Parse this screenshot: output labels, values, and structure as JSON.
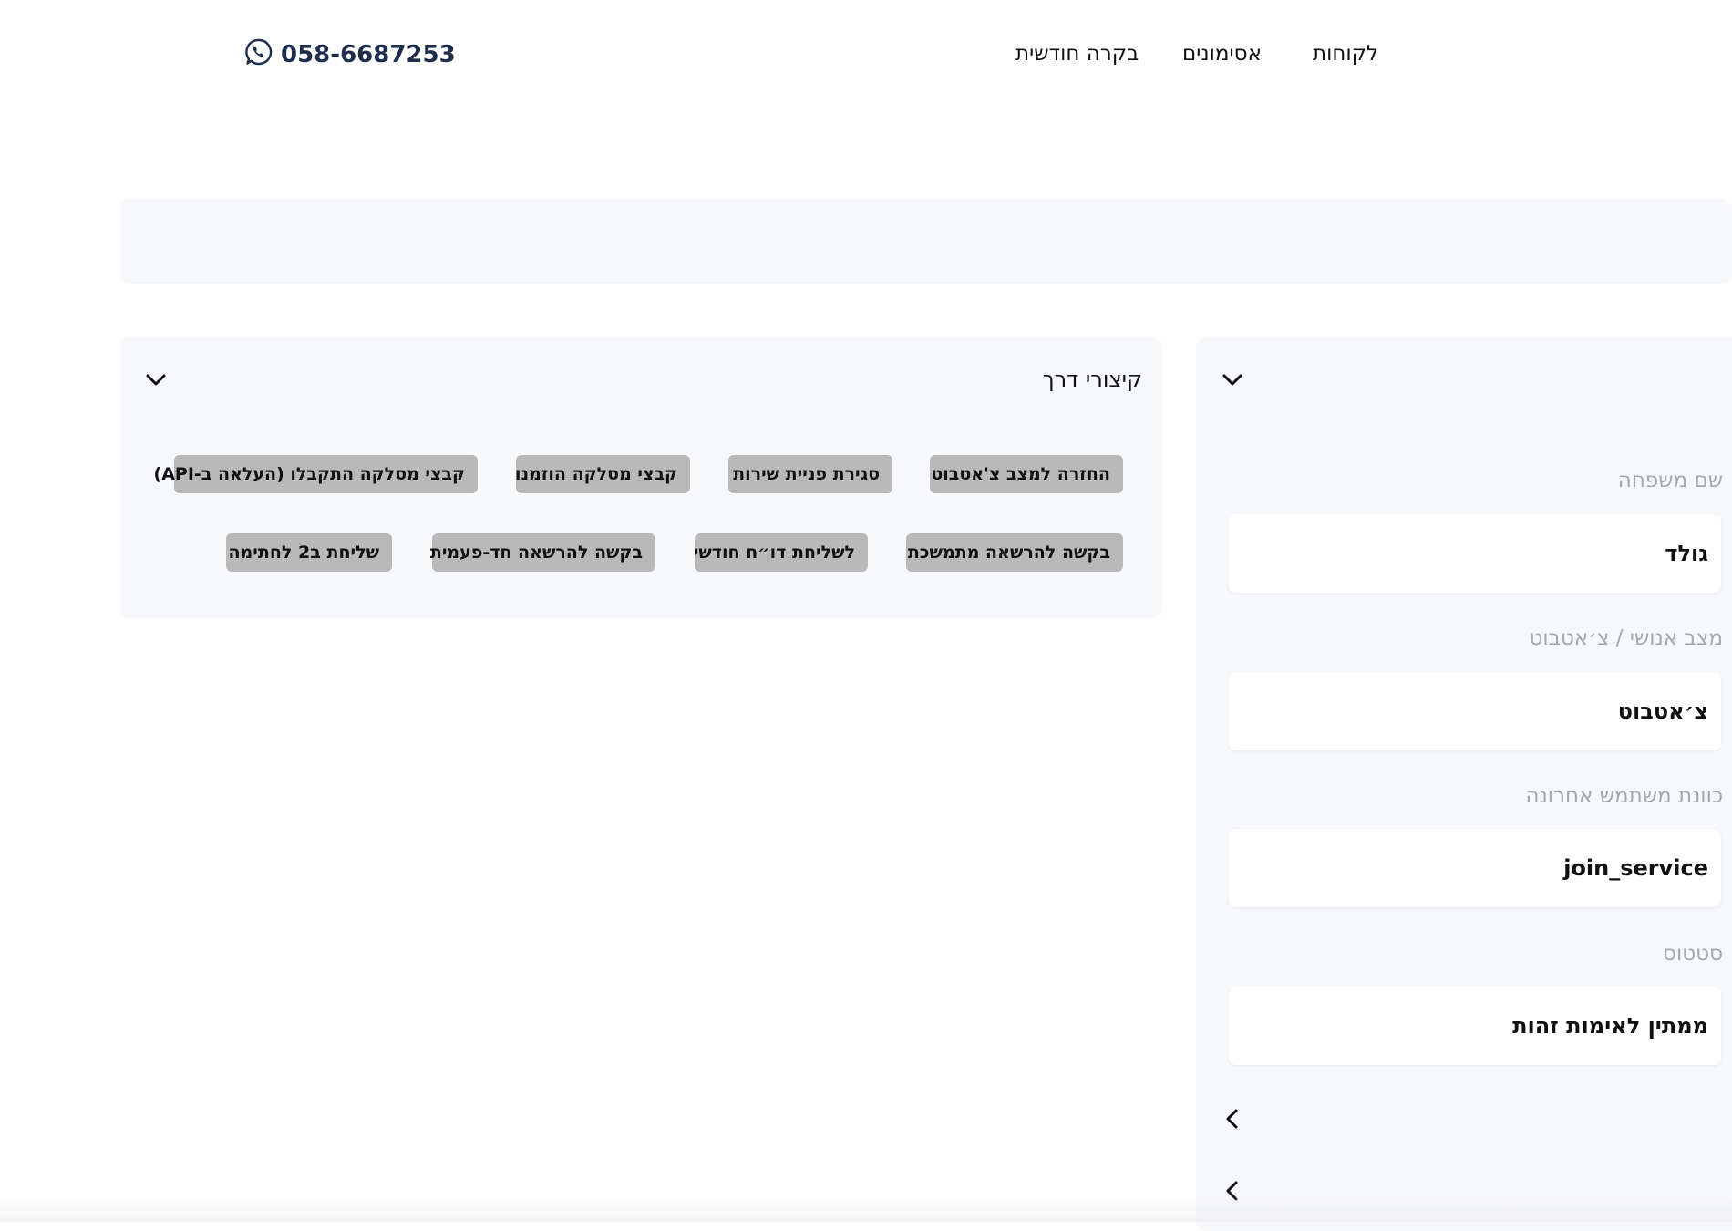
{
  "header": {
    "phone": "058-6687253",
    "phone_icon": "whatsapp-icon",
    "nav": [
      {
        "label": "לקוחות"
      },
      {
        "label": "אסימונים"
      },
      {
        "label": "בקרה חודשית"
      }
    ]
  },
  "shortcuts": {
    "title": "קיצורי דרך",
    "chips_row1": [
      "החזרה למצב צ'אטבוט",
      "סגירת פניית שירות",
      "קבצי מסלקה הוזמנו",
      "קבצי מסלקה התקבלו (העלאה ב-API)"
    ],
    "chips_row2": [
      "בקשה להרשאה מתמשכת",
      "לשליחת דו״ח חודשי",
      "בקשה להרשאה חד-פעמית",
      "שליחת ב2 לחתימה"
    ]
  },
  "details": {
    "fields": [
      {
        "label": "שם משפחה",
        "value": "גולד"
      },
      {
        "label": "מצב אנושי / צ׳אטבוט",
        "value": "צ׳אטבוט"
      },
      {
        "label": "כוונת משתמש אחרונה",
        "value": "join_service"
      },
      {
        "label": "סטטוס",
        "value": "ממתין לאימות זהות"
      }
    ]
  },
  "colors": {
    "panel_bg": "#f7f8fb",
    "chip_bg": "#b9b9b9",
    "phone_text": "#1f2d4d",
    "label_gray": "#a5a8ad"
  }
}
